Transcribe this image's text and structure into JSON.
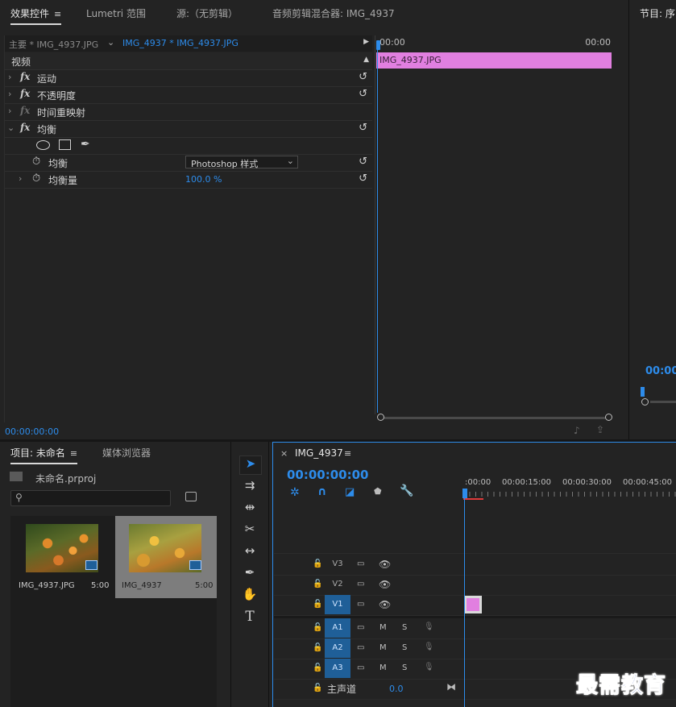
{
  "effects_panel": {
    "tabs": [
      {
        "label": "效果控件",
        "active": true
      },
      {
        "label": "Lumetri 范围"
      },
      {
        "label": "源:（无剪辑）"
      },
      {
        "label": "音频剪辑混合器: IMG_4937"
      }
    ],
    "menu_icon": "≡",
    "master_tab": "主要 * IMG_4937.JPG",
    "clip_tab": "IMG_4937 * IMG_4937.JPG",
    "section_video": "视频",
    "effects": [
      {
        "label": "运动"
      },
      {
        "label": "不透明度"
      },
      {
        "label": "时间重映射"
      },
      {
        "label": "均衡"
      }
    ],
    "equalize_param_label": "均衡",
    "equalize_param_value": "Photoshop 样式",
    "amount_label": "均衡量",
    "amount_value": "100.0 %",
    "mini_timeline": {
      "start": "00:00",
      "end": "00:00",
      "clip_label": "IMG_4937.JPG",
      "clip_color": "#e17fe0"
    },
    "timecode": "00:00:00:00"
  },
  "program_panel": {
    "tab": "节目: 序",
    "timecode": "00:00:"
  },
  "project_panel": {
    "tabs": [
      {
        "label": "项目: 未命名",
        "active": true
      },
      {
        "label": "媒体浏览器"
      }
    ],
    "project_file": "未命名.prproj",
    "search_placeholder": "",
    "items": [
      {
        "name": "IMG_4937.JPG",
        "duration": "5:00"
      },
      {
        "name": "IMG_4937",
        "duration": "5:00"
      }
    ]
  },
  "timeline_panel": {
    "sequence_name": "IMG_4937",
    "close_glyph": "×",
    "timecode": "00:00:00:00",
    "ruler": [
      ":00:00",
      "00:00:15:00",
      "00:00:30:00",
      "00:00:45:00"
    ],
    "tracks_video": [
      {
        "label": "V3",
        "active": false
      },
      {
        "label": "V2",
        "active": false
      },
      {
        "label": "V1",
        "active": true
      }
    ],
    "tracks_audio": [
      {
        "label": "A1"
      },
      {
        "label": "A2"
      },
      {
        "label": "A3"
      }
    ],
    "mute": "M",
    "solo": "S",
    "master_label": "主声道",
    "master_value": "0.0",
    "clip_color": "#e17fe0"
  },
  "watermark": "最需教育",
  "accent": "#2d8ceb"
}
